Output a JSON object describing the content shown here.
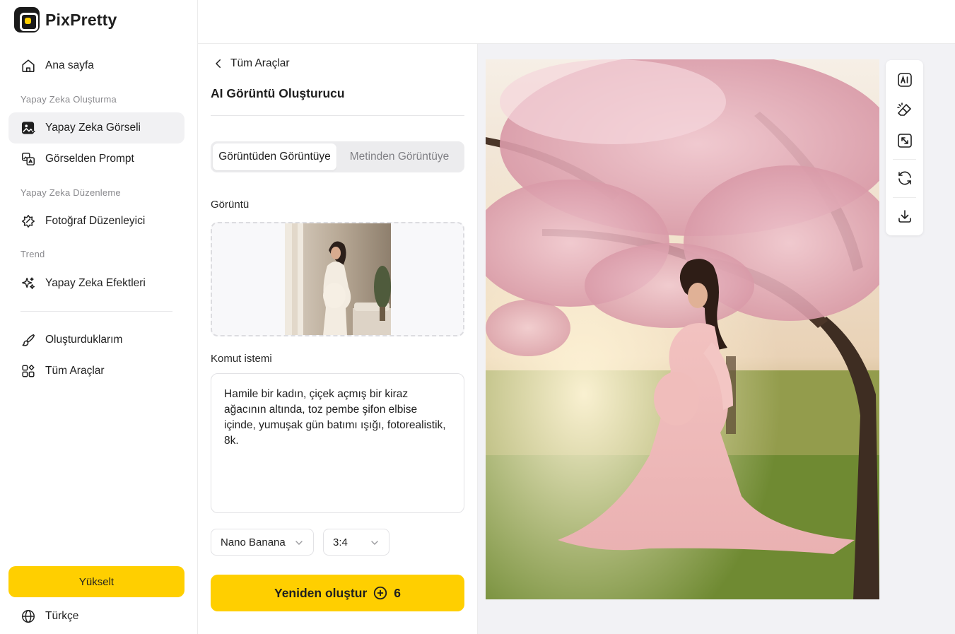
{
  "app": {
    "name": "PixPretty"
  },
  "sidebar": {
    "home": "Ana sayfa",
    "section_create": "Yapay Zeka Oluşturma",
    "ai_image": "Yapay Zeka Görseli",
    "image_to_prompt": "Görselden Prompt",
    "section_edit": "Yapay Zeka Düzenleme",
    "photo_editor": "Fotoğraf Düzenleyici",
    "section_trend": "Trend",
    "ai_effects": "Yapay Zeka Efektleri",
    "my_creations": "Oluşturduklarım",
    "all_tools": "Tüm Araçlar",
    "upgrade": "Yükselt",
    "language": "Türkçe"
  },
  "panel": {
    "back_label": "Tüm Araçlar",
    "title": "AI Görüntü Oluşturucu",
    "tabs": [
      {
        "label": "Görüntüden Görüntüye",
        "active": true
      },
      {
        "label": "Metinden Görüntüye",
        "active": false
      }
    ],
    "image_label": "Görüntü",
    "prompt_label": "Komut istemi",
    "prompt_value": "Hamile bir kadın, çiçek açmış bir kiraz ağacının altında, toz pembe şifon elbise içinde, yumuşak gün batımı ışığı, fotorealistik, 8k.",
    "model_select": "Nano Banana",
    "ratio_select": "3:4",
    "generate_label": "Yeniden oluştur",
    "generate_cost": "6"
  },
  "colors": {
    "accent": "#ffcf00",
    "active_nav_bg": "#f1f1f3",
    "preview_bg": "#f2f2f5"
  },
  "toolbar_icons": [
    "ai-icon",
    "eraser-icon",
    "expand-icon",
    "refresh-icon",
    "download-icon"
  ]
}
